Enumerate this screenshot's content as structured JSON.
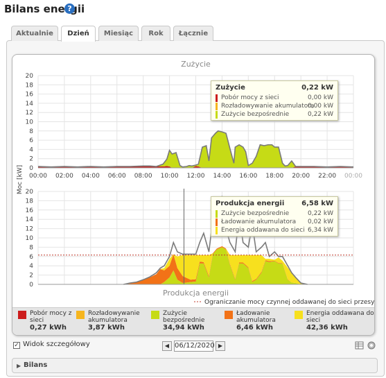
{
  "page": {
    "title": "Bilans energii"
  },
  "tabs": [
    {
      "label": "Aktualnie",
      "active": false
    },
    {
      "label": "Dzień",
      "active": true
    },
    {
      "label": "Miesiąc",
      "active": false
    },
    {
      "label": "Rok",
      "active": false
    },
    {
      "label": "Łącznie",
      "active": false
    }
  ],
  "colors": {
    "grid": "#cc1c1c",
    "battery_discharge": "#f6b51e",
    "direct": "#c6db16",
    "battery_charge": "#f27217",
    "feed_in": "#f7e01e",
    "line": "#7a7a7a",
    "limit": "#c0392b"
  },
  "chart_data": [
    {
      "type": "area",
      "title": "Zużycie",
      "ylabel": "Moc [kW]",
      "ylim": [
        0,
        20
      ],
      "yticks": [
        0,
        2,
        4,
        6,
        8,
        10,
        12,
        14,
        16,
        18,
        20
      ],
      "xlim": [
        0,
        24
      ],
      "xticks": [
        "00:00",
        "02:00",
        "04:00",
        "06:00",
        "08:00",
        "10:00",
        "12:00",
        "14:00",
        "16:00",
        "18:00",
        "20:00",
        "22:00",
        "00:00"
      ],
      "x": [
        0,
        1,
        2,
        3,
        4,
        5,
        6,
        7,
        8,
        8.5,
        9,
        9.5,
        9.8,
        10,
        10.2,
        10.5,
        10.8,
        11,
        11.3,
        11.5,
        11.7,
        12,
        12.2,
        12.5,
        12.8,
        13,
        13.2,
        13.5,
        13.7,
        14,
        14.3,
        14.6,
        14.9,
        15,
        15.3,
        15.6,
        15.8,
        16,
        16.3,
        16.6,
        16.9,
        17.2,
        17.5,
        17.8,
        18,
        18.3,
        18.6,
        18.8,
        19,
        19.3,
        19.6,
        20,
        21,
        22,
        23,
        24
      ],
      "series": [
        {
          "name": "Pobór mocy z sieci",
          "values": [
            0.3,
            0.2,
            0.3,
            0.2,
            0.3,
            0.2,
            0.3,
            0.3,
            0.4,
            0.4,
            0.3,
            0.3,
            0.4,
            0.3,
            0,
            0,
            0,
            0,
            0,
            0,
            0,
            0.4,
            0.3,
            0,
            0,
            0,
            0,
            0,
            0,
            0,
            0,
            0,
            0,
            0,
            0,
            0,
            0,
            0,
            0,
            0,
            0,
            0,
            0,
            0,
            0,
            0,
            0,
            0,
            0,
            0,
            0.3,
            0.3,
            0.3,
            0.2,
            0.3,
            0.2
          ]
        },
        {
          "name": "Rozładowywanie akumulatora",
          "values": [
            0,
            0,
            0,
            0,
            0,
            0,
            0,
            0,
            0,
            0,
            0,
            0,
            0,
            0,
            0,
            0,
            0,
            0,
            0,
            0,
            0,
            0,
            0,
            0,
            0,
            0,
            0,
            0,
            0,
            0,
            0,
            0,
            0,
            0,
            0,
            0,
            0,
            0,
            0,
            0,
            0,
            0,
            0,
            0,
            0,
            0,
            0,
            0,
            0,
            0,
            0,
            0,
            0,
            0,
            0,
            0
          ]
        },
        {
          "name": "Zużycie bezpośrednie",
          "values": [
            0,
            0,
            0,
            0,
            0,
            0,
            0,
            0,
            0,
            0,
            0,
            0.5,
            1.5,
            3.5,
            3,
            3.3,
            0.5,
            0.2,
            0.3,
            0.5,
            0.4,
            0.2,
            0.5,
            4.5,
            4.8,
            1.5,
            6.5,
            7.5,
            8,
            7.8,
            7.5,
            4.2,
            1,
            4.5,
            5,
            4.5,
            3.5,
            0.5,
            1,
            2.5,
            5,
            4.8,
            5,
            5,
            4.5,
            4.5,
            1,
            0.4,
            0.5,
            1.5,
            0,
            0,
            0,
            0,
            0,
            0
          ]
        }
      ],
      "total_line": [
        0.3,
        0.2,
        0.3,
        0.2,
        0.3,
        0.2,
        0.3,
        0.3,
        0.4,
        0.4,
        0.3,
        0.8,
        1.9,
        3.8,
        3,
        3.3,
        0.5,
        0.2,
        0.3,
        0.5,
        0.4,
        0.6,
        0.8,
        4.5,
        4.8,
        1.5,
        6.5,
        7.5,
        8,
        7.8,
        7.5,
        4.2,
        1,
        4.5,
        5,
        4.5,
        3.5,
        0.5,
        1,
        2.5,
        5,
        4.8,
        5,
        5,
        4.5,
        4.5,
        1,
        0.4,
        0.5,
        1.5,
        0.3,
        0.3,
        0.3,
        0.2,
        0.3,
        0.2
      ],
      "tooltip": {
        "title": "Zużycie",
        "total": "0,22 kW",
        "rows": [
          {
            "label": "Pobór mocy z sieci",
            "value": "0,00 kW",
            "color": "#cc1c1c"
          },
          {
            "label": "Rozładowywanie akumulatora",
            "value": "0,00 kW",
            "color": "#f6b51e"
          },
          {
            "label": "Zużycie bezpośrednie",
            "value": "0,22 kW",
            "color": "#c6db16"
          }
        ]
      }
    },
    {
      "type": "area",
      "title": "Produkcja energii",
      "ylim": [
        0,
        20
      ],
      "yticks": [
        0,
        2,
        4,
        6,
        8,
        10,
        12,
        14,
        16,
        18,
        20
      ],
      "xlim": [
        0,
        24
      ],
      "limit_value": 6.3,
      "limit_label": "Ograniczanie mocy czynnej oddawanej do sieci przesyłowej",
      "cursor_x": 11.1,
      "x": [
        6.5,
        7,
        7.5,
        8,
        8.5,
        9,
        9.3,
        9.6,
        10,
        10.3,
        10.6,
        11,
        11.3,
        11.6,
        12,
        12.3,
        12.6,
        13,
        13.3,
        13.6,
        14,
        14.3,
        14.6,
        15,
        15.3,
        15.6,
        16,
        16.3,
        16.6,
        17,
        17.3,
        17.6,
        18,
        18.3,
        18.6,
        19,
        19.3,
        19.6,
        20,
        20.5
      ],
      "series": [
        {
          "name": "Zużycie bezpośrednie",
          "values": [
            0,
            0,
            0,
            0,
            0,
            0,
            0,
            0.5,
            1.5,
            3,
            1,
            0.3,
            0.4,
            0.5,
            0.6,
            4.5,
            4.5,
            1.5,
            6.5,
            7.5,
            8,
            7.5,
            4.2,
            1,
            4.5,
            4.5,
            3.5,
            0.5,
            1,
            2.5,
            5,
            4.8,
            5,
            4.5,
            4.5,
            1,
            0.4,
            0.3,
            0,
            0
          ]
        },
        {
          "name": "Ładowanie akumulatora",
          "values": [
            0,
            0.2,
            0.5,
            1,
            1.5,
            2.2,
            3.3,
            2.5,
            2.5,
            3.5,
            2.5,
            1.5,
            1,
            0.5,
            0.5,
            0.4,
            0.3,
            0.3,
            0.2,
            0.2,
            0.2,
            0.2,
            0.2,
            0.2,
            0.2,
            0.2,
            0.2,
            0.2,
            0.2,
            0.2,
            0.2,
            0.2,
            0.1,
            0.1,
            0.1,
            0.1,
            0,
            0,
            0,
            0
          ]
        },
        {
          "name": "Energia oddawana do sieci",
          "values": [
            0,
            0,
            0,
            0,
            0,
            0,
            0,
            0.5,
            1.5,
            0,
            2.5,
            4.5,
            4.9,
            5.3,
            5.2,
            1.4,
            1.5,
            4.5,
            0,
            0,
            0,
            0,
            1.9,
            5.1,
            1.6,
            1.6,
            2.6,
            5.6,
            5.1,
            3.6,
            0.3,
            0.5,
            0.2,
            1.2,
            0.5,
            2.5,
            2.1,
            1.2,
            0.3,
            0
          ]
        }
      ],
      "total_line": [
        0,
        0.3,
        0.5,
        1,
        1.6,
        2.5,
        3.5,
        4,
        6,
        9,
        7,
        6.5,
        6.5,
        6.5,
        6.5,
        9,
        11,
        7,
        14,
        12,
        19,
        12,
        9,
        7,
        15,
        9,
        8,
        13,
        7,
        8,
        9,
        6,
        7,
        6,
        6,
        4,
        2.5,
        1.5,
        0.3,
        0
      ],
      "tooltip": {
        "title": "Produkcja energii",
        "total": "6,58 kW",
        "rows": [
          {
            "label": "Zużycie bezpośrednie",
            "value": "0,22 kW",
            "color": "#c6db16"
          },
          {
            "label": "Ładowanie akumulatora",
            "value": "0,02 kW",
            "color": "#f27217"
          },
          {
            "label": "Energia oddawana do sieci",
            "value": "6,34 kW",
            "color": "#f7e01e"
          }
        ]
      }
    }
  ],
  "legend": [
    {
      "label": "Pobór mocy z sieci",
      "value": "0,27 kWh",
      "color": "#cc1c1c"
    },
    {
      "label": "Rozładowywanie akumulatora",
      "value": "3,87 kWh",
      "color": "#f6b51e"
    },
    {
      "label": "Zużycie bezpośrednie",
      "value": "34,94 kWh",
      "color": "#c6db16"
    },
    {
      "label": "Ładowanie akumulatora",
      "value": "6,46 kWh",
      "color": "#f27217"
    },
    {
      "label": "Energia oddawana do sieci",
      "value": "42,36 kWh",
      "color": "#f7e01e"
    }
  ],
  "controls": {
    "detail_label": "Widok szczegółowy",
    "detail_checked": true,
    "date": "06/12/2020",
    "prev_icon": "arrow-left-icon",
    "next_icon": "arrow-right-icon"
  },
  "bilans": {
    "label": "Bilans"
  }
}
